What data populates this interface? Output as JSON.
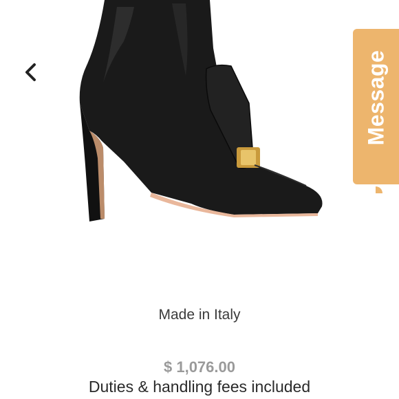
{
  "gallery": {
    "prev_icon": "chevron-left-icon",
    "image_subject": "black-leather-heeled-ankle-boot"
  },
  "message_widget": {
    "label": "Message",
    "icon": "chat-bubble-icon",
    "color": "#edb56d"
  },
  "product": {
    "origin": "Made in Italy",
    "price": "$ 1,076.00",
    "duties_note": "Duties & handling fees included"
  }
}
